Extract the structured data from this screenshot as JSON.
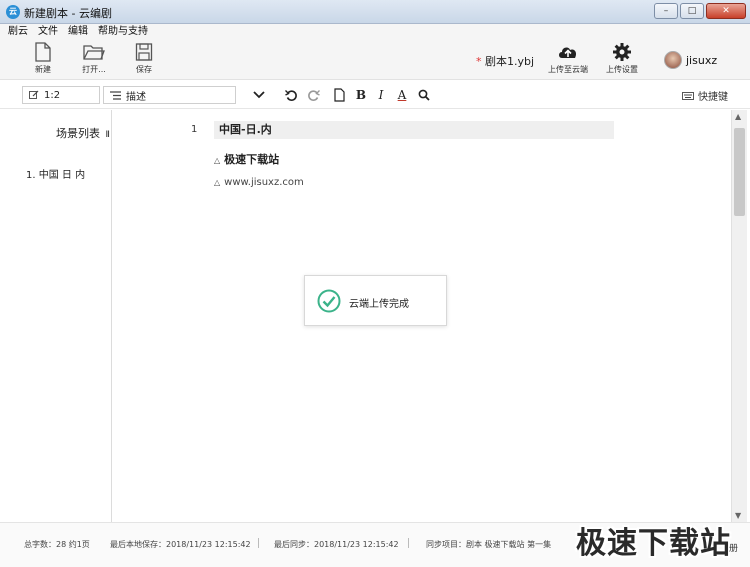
{
  "window": {
    "title": "新建剧本 - 云编剧",
    "app_icon_text": "云",
    "minimize": "–",
    "maximize": "□",
    "close": "✕"
  },
  "menu": [
    "剧云",
    "文件",
    "编辑",
    "帮助与支持"
  ],
  "toolbar": {
    "new_label": "新建",
    "open_label": "打开...",
    "save_label": "保存",
    "filename_marker": "*",
    "filename": "剧本1.ybj",
    "upload_cloud_label": "上传至云端",
    "upload_settings_label": "上传设置",
    "username": "jisuxz"
  },
  "format": {
    "position_value": "1:2",
    "element_type": "描述",
    "bold": "B",
    "italic": "I",
    "underline_color": "A",
    "shortcut_label": "快捷键"
  },
  "scene_list": {
    "title": "场景列表",
    "title_tail": "Ⅱ",
    "items": [
      "1. 中国 日 内"
    ]
  },
  "editor": {
    "line_number": "1",
    "scene_heading": "中国-日.内",
    "lines": [
      "极速下载站",
      "www.jisuxz.com"
    ],
    "marker": "△"
  },
  "toast": {
    "message": "云端上传完成"
  },
  "status": {
    "word_count": "总字数：28 约1页",
    "local_save": "最后本地保存：2018/11/23 12:15:42",
    "last_sync": "最后同步：2018/11/23 12:15:42",
    "sync_project": "同步项目：剧本 极速下载站 第一集"
  },
  "watermark": {
    "text": "极速下载站",
    "tail": "册"
  },
  "colors": {
    "accent": "#2a8fd6",
    "success": "#3bb38a"
  }
}
